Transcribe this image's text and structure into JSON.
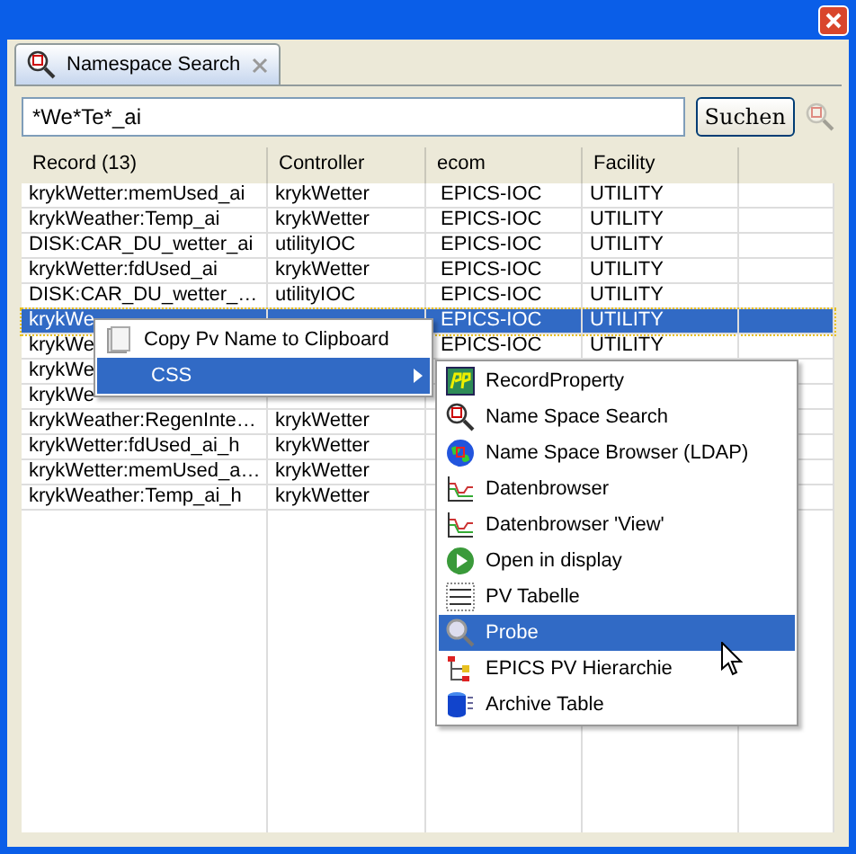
{
  "tab": {
    "label": "Namespace Search",
    "selected": true
  },
  "search": {
    "value": "*We*Te*_ai",
    "button": "Suchen"
  },
  "table": {
    "columns": [
      "Record (13)",
      "Controller",
      "ecom",
      "Facility"
    ],
    "rows": [
      {
        "cells": [
          "krykWetter:memUsed_ai",
          "krykWetter",
          "EPICS-IOC",
          "UTILITY"
        ],
        "selected": false
      },
      {
        "cells": [
          "krykWeather:Temp_ai",
          "krykWetter",
          "EPICS-IOC",
          "UTILITY"
        ],
        "selected": false
      },
      {
        "cells": [
          "DISK:CAR_DU_wetter_ai",
          "utilityIOC",
          "EPICS-IOC",
          "UTILITY"
        ],
        "selected": false
      },
      {
        "cells": [
          "krykWetter:fdUsed_ai",
          "krykWetter",
          "EPICS-IOC",
          "UTILITY"
        ],
        "selected": false
      },
      {
        "cells": [
          "DISK:CAR_DU_wetter_…",
          "utilityIOC",
          "EPICS-IOC",
          "UTILITY"
        ],
        "selected": false
      },
      {
        "cells": [
          "krykWe",
          "",
          "EPICS-IOC",
          "UTILITY"
        ],
        "selected": true
      },
      {
        "cells": [
          "krykWe",
          "",
          "EPICS-IOC",
          "UTILITY"
        ],
        "selected": false
      },
      {
        "cells": [
          "krykWe",
          "",
          "",
          ""
        ],
        "selected": false
      },
      {
        "cells": [
          "krykWe",
          "",
          "",
          ""
        ],
        "selected": false
      },
      {
        "cells": [
          "krykWeather:RegenInte…",
          "krykWetter",
          "",
          ""
        ],
        "selected": false
      },
      {
        "cells": [
          "krykWetter:fdUsed_ai_h",
          "krykWetter",
          "",
          ""
        ],
        "selected": false
      },
      {
        "cells": [
          "krykWetter:memUsed_a…",
          "krykWetter",
          "",
          ""
        ],
        "selected": false
      },
      {
        "cells": [
          "krykWeather:Temp_ai_h",
          "krykWetter",
          "",
          ""
        ],
        "selected": false
      }
    ]
  },
  "context_menu": {
    "items": [
      {
        "label": "Copy Pv Name to Clipboard",
        "kind": "copy",
        "selected": false
      },
      {
        "label": "CSS",
        "kind": "submenu",
        "selected": true
      }
    ]
  },
  "submenu": {
    "items": [
      {
        "label": "RecordProperty",
        "kind": "rp",
        "selected": false
      },
      {
        "label": "Name Space Search",
        "kind": "search",
        "selected": false
      },
      {
        "label": "Name Space Browser (LDAP)",
        "kind": "globe",
        "selected": false
      },
      {
        "label": "Datenbrowser",
        "kind": "chart",
        "selected": false
      },
      {
        "label": "Datenbrowser 'View'",
        "kind": "chart",
        "selected": false
      },
      {
        "label": "Open in display",
        "kind": "play",
        "selected": false
      },
      {
        "label": "PV Tabelle",
        "kind": "table",
        "selected": false
      },
      {
        "label": "Probe",
        "kind": "probe",
        "selected": true
      },
      {
        "label": "EPICS PV Hierarchie",
        "kind": "tree",
        "selected": false
      },
      {
        "label": "Archive Table",
        "kind": "archive",
        "selected": false
      }
    ]
  }
}
